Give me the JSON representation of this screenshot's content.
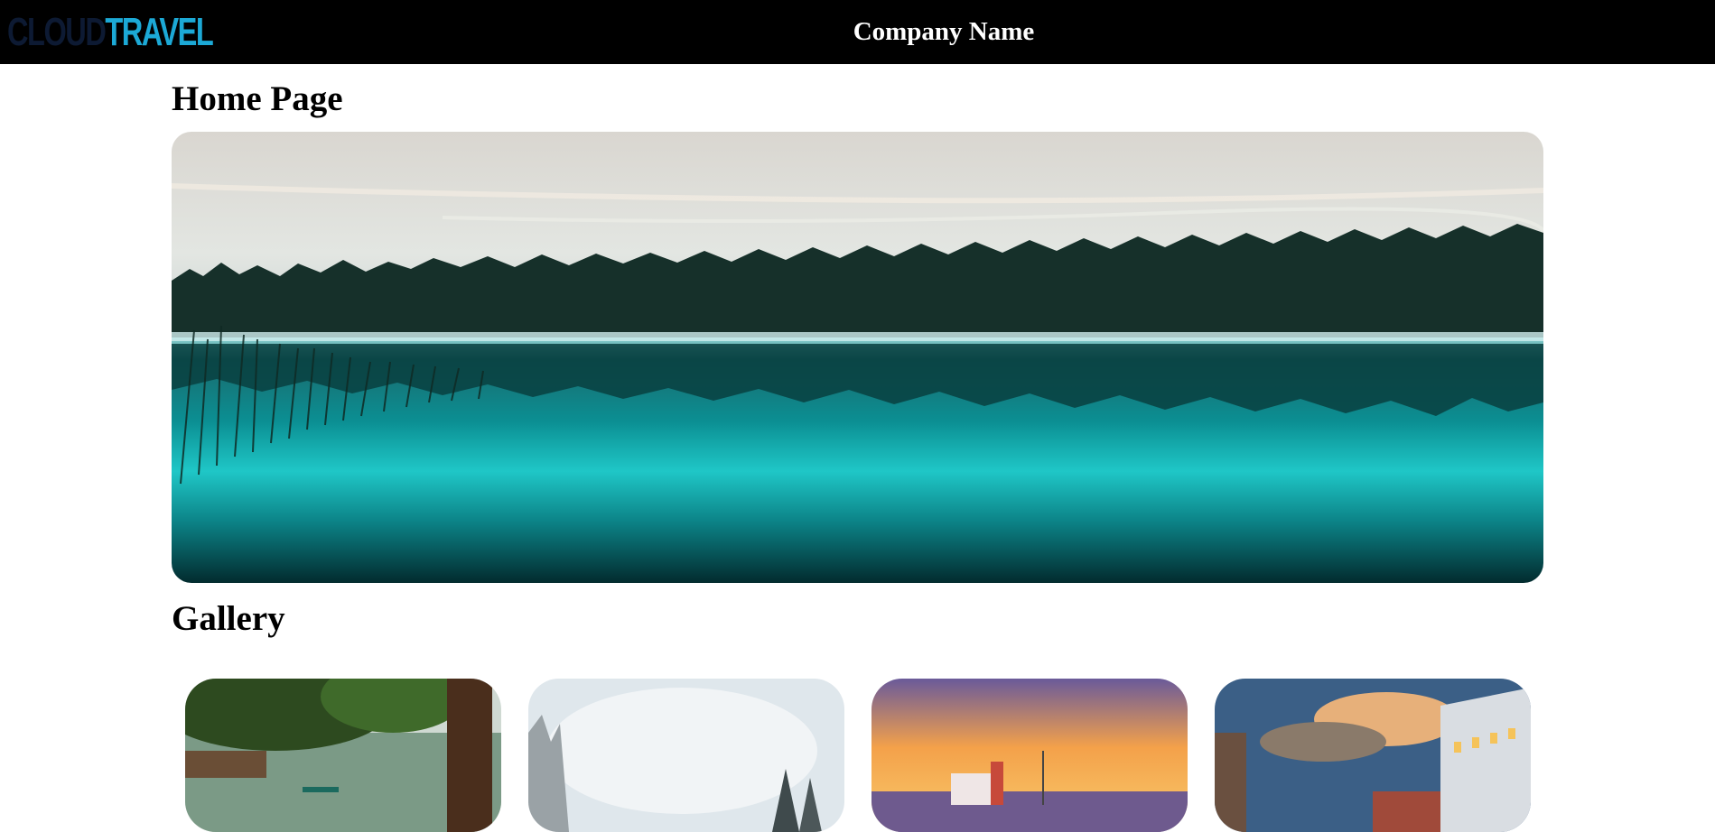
{
  "header": {
    "logo_part_a": "CLOUD",
    "logo_part_b": "TRAVEL",
    "company_name": "Company Name"
  },
  "main": {
    "home_title": "Home Page",
    "hero_image": "misty-lake-forest-reflection",
    "gallery_title": "Gallery",
    "gallery_images": [
      "park-lake-trees",
      "snowy-forest-sky",
      "sunset-sea-building",
      "city-street-dusk"
    ]
  },
  "colors": {
    "header_bg": "#000000",
    "logo_dark": "#0d1a33",
    "logo_accent": "#1ca9d6",
    "page_bg": "#ffffff"
  }
}
